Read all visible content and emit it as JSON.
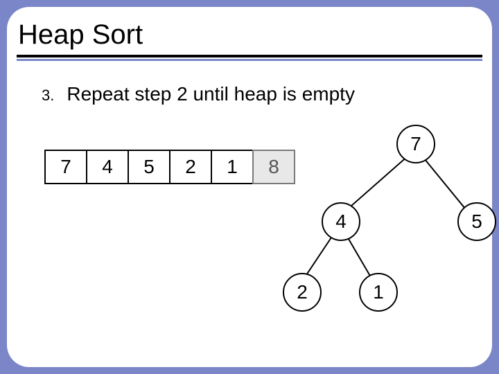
{
  "title": "Heap Sort",
  "step_number": "3.",
  "step_text": "Repeat step 2 until heap is empty",
  "array": [
    "7",
    "4",
    "5",
    "2",
    "1",
    "8"
  ],
  "array_sorted_flags": [
    false,
    false,
    false,
    false,
    false,
    true
  ],
  "tree": {
    "root": "7",
    "left": "4",
    "right": "5",
    "left_left": "2",
    "left_right": "1"
  },
  "chart_data": {
    "type": "table",
    "title": "Heap state during Heap Sort after one extraction",
    "array_values": [
      7,
      4,
      5,
      2,
      1,
      8
    ],
    "sorted_suffix_start_index": 5,
    "heap_tree": {
      "value": 7,
      "children": [
        {
          "value": 4,
          "children": [
            {
              "value": 2
            },
            {
              "value": 1
            }
          ]
        },
        {
          "value": 5
        }
      ]
    }
  }
}
